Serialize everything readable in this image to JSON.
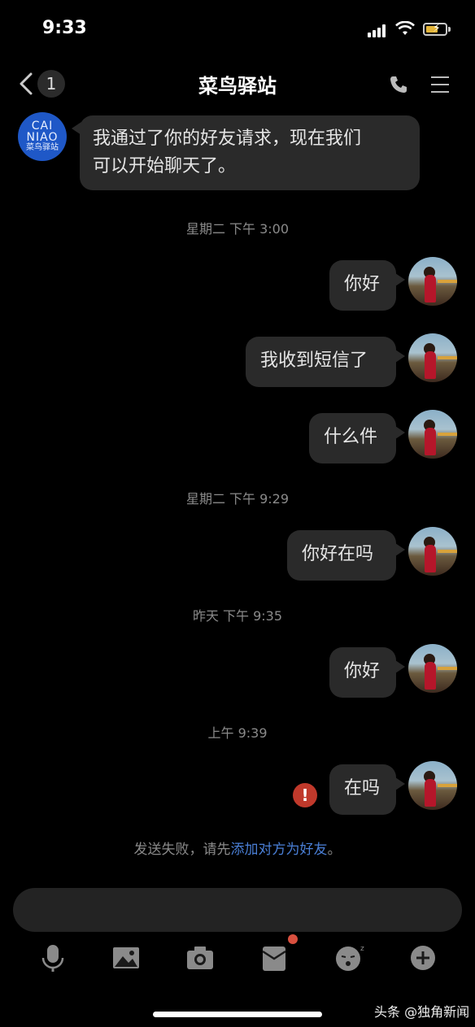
{
  "status_bar": {
    "time": "9:33"
  },
  "nav": {
    "back_badge": "1",
    "title": "菜鸟驿站"
  },
  "contact_avatar": {
    "line1": "CAI",
    "line2": "NIAO",
    "line3": "菜鸟驿站"
  },
  "messages": {
    "incoming_1": {
      "line1": "我通过了你的好友请求，现在我们",
      "line2": "可以开始聊天了。"
    },
    "ts_1": "星期二 下午 3:00",
    "out_1": "你好",
    "out_2": "我收到短信了",
    "out_3": "什么件",
    "ts_2": "星期二 下午 9:29",
    "out_4": "你好在吗",
    "ts_3": "昨天 下午 9:35",
    "out_5": "你好",
    "ts_4": "上午 9:39",
    "out_6": "在吗",
    "error_mark": "!"
  },
  "notice": {
    "prefix": "发送失败，请先",
    "link": "添加对方为好友",
    "suffix": "。"
  },
  "input": {
    "value": "",
    "placeholder": ""
  },
  "toolbar": {
    "icons": [
      "microphone-icon",
      "image-icon",
      "camera-icon",
      "red-packet-icon",
      "emoji-icon",
      "plus-icon"
    ]
  },
  "watermark": "头条 @独角新闻",
  "colors": {
    "accent_link": "#4a7fd6",
    "bubble": "#2a2a2a",
    "error": "#c0392b",
    "contact_avatar": "#1f58c7"
  }
}
